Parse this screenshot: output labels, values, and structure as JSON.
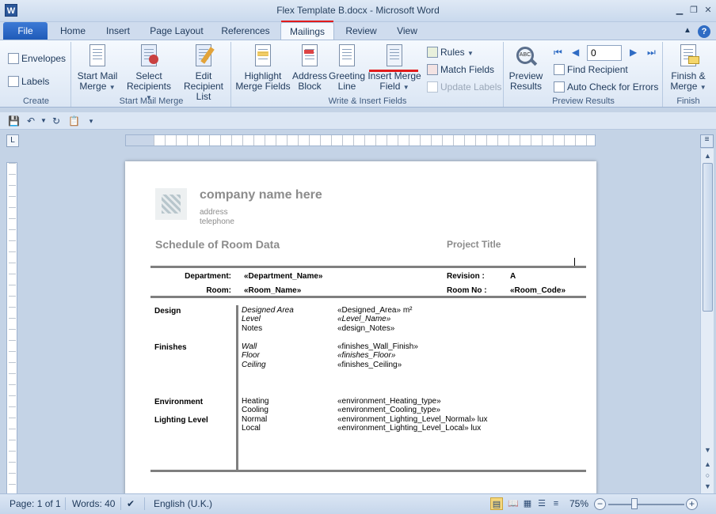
{
  "window": {
    "title": "Flex Template B.docx - Microsoft Word",
    "app_icon": "W"
  },
  "tabs": [
    "File",
    "Home",
    "Insert",
    "Page Layout",
    "References",
    "Mailings",
    "Review",
    "View"
  ],
  "ribbon": {
    "create": {
      "label": "Create",
      "envelopes": "Envelopes",
      "labels": "Labels"
    },
    "start_mail_merge": {
      "label": "Start Mail Merge",
      "start": [
        "Start Mail",
        "Merge"
      ],
      "select": [
        "Select",
        "Recipients"
      ],
      "edit": [
        "Edit",
        "Recipient List"
      ]
    },
    "write_insert": {
      "label": "Write & Insert Fields",
      "highlight": [
        "Highlight",
        "Merge Fields"
      ],
      "address": [
        "Address",
        "Block"
      ],
      "greeting": [
        "Greeting",
        "Line"
      ],
      "insert_field": [
        "Insert Merge",
        "Field"
      ],
      "rules": "Rules",
      "match_fields": "Match Fields",
      "update_labels": "Update Labels"
    },
    "preview": {
      "label": "Preview Results",
      "preview_btn": [
        "Preview",
        "Results"
      ],
      "record": "0",
      "find_recipient": "Find Recipient",
      "auto_check": "Auto Check for Errors"
    },
    "finish": {
      "label": "Finish",
      "finish_btn": [
        "Finish &",
        "Merge"
      ]
    }
  },
  "document": {
    "company": "company name here",
    "address": "address",
    "telephone": "telephone",
    "schedule_title": "Schedule of Room Data",
    "project_title": "Project Title",
    "department_label": "Department:",
    "department_value": "«Department_Name»",
    "revision_label": "Revision :",
    "revision_value": "A",
    "room_label": "Room:",
    "room_value": "«Room_Name»",
    "room_no_label": "Room No :",
    "room_no_value": "«Room_Code»",
    "sections": {
      "design": "Design",
      "finishes": "Finishes",
      "environment": "Environment",
      "lighting": "Lighting Level"
    },
    "design_rows": [
      {
        "label": "Designed Area",
        "value": "«Designed_Area» m²"
      },
      {
        "label": "Level",
        "value": "«Level_Name»"
      },
      {
        "label": "Notes",
        "value": "«design_Notes»"
      }
    ],
    "finishes_rows": [
      {
        "label": "Wall",
        "value": "«finishes_Wall_Finish»"
      },
      {
        "label": "Floor",
        "value": "«finishes_Floor»"
      },
      {
        "label": "Ceiling",
        "value": "«finishes_Ceiling»"
      }
    ],
    "environment_rows": [
      {
        "label": "Heating",
        "value": "«environment_Heating_type»"
      },
      {
        "label": "Cooling",
        "value": "«environment_Cooling_type»"
      },
      {
        "label": "Normal",
        "value": "«environment_Lighting_Level_Normal» lux"
      },
      {
        "label": "Local",
        "value": "«environment_Lighting_Level_Local» lux"
      }
    ]
  },
  "status": {
    "page": "Page: 1 of 1",
    "words": "Words: 40",
    "language": "English (U.K.)",
    "zoom": "75%"
  },
  "colors": {
    "annotation_red": "#e21b1b",
    "file_tab": "#2b67c5",
    "ribbon_bg": "#dbe6f4"
  }
}
